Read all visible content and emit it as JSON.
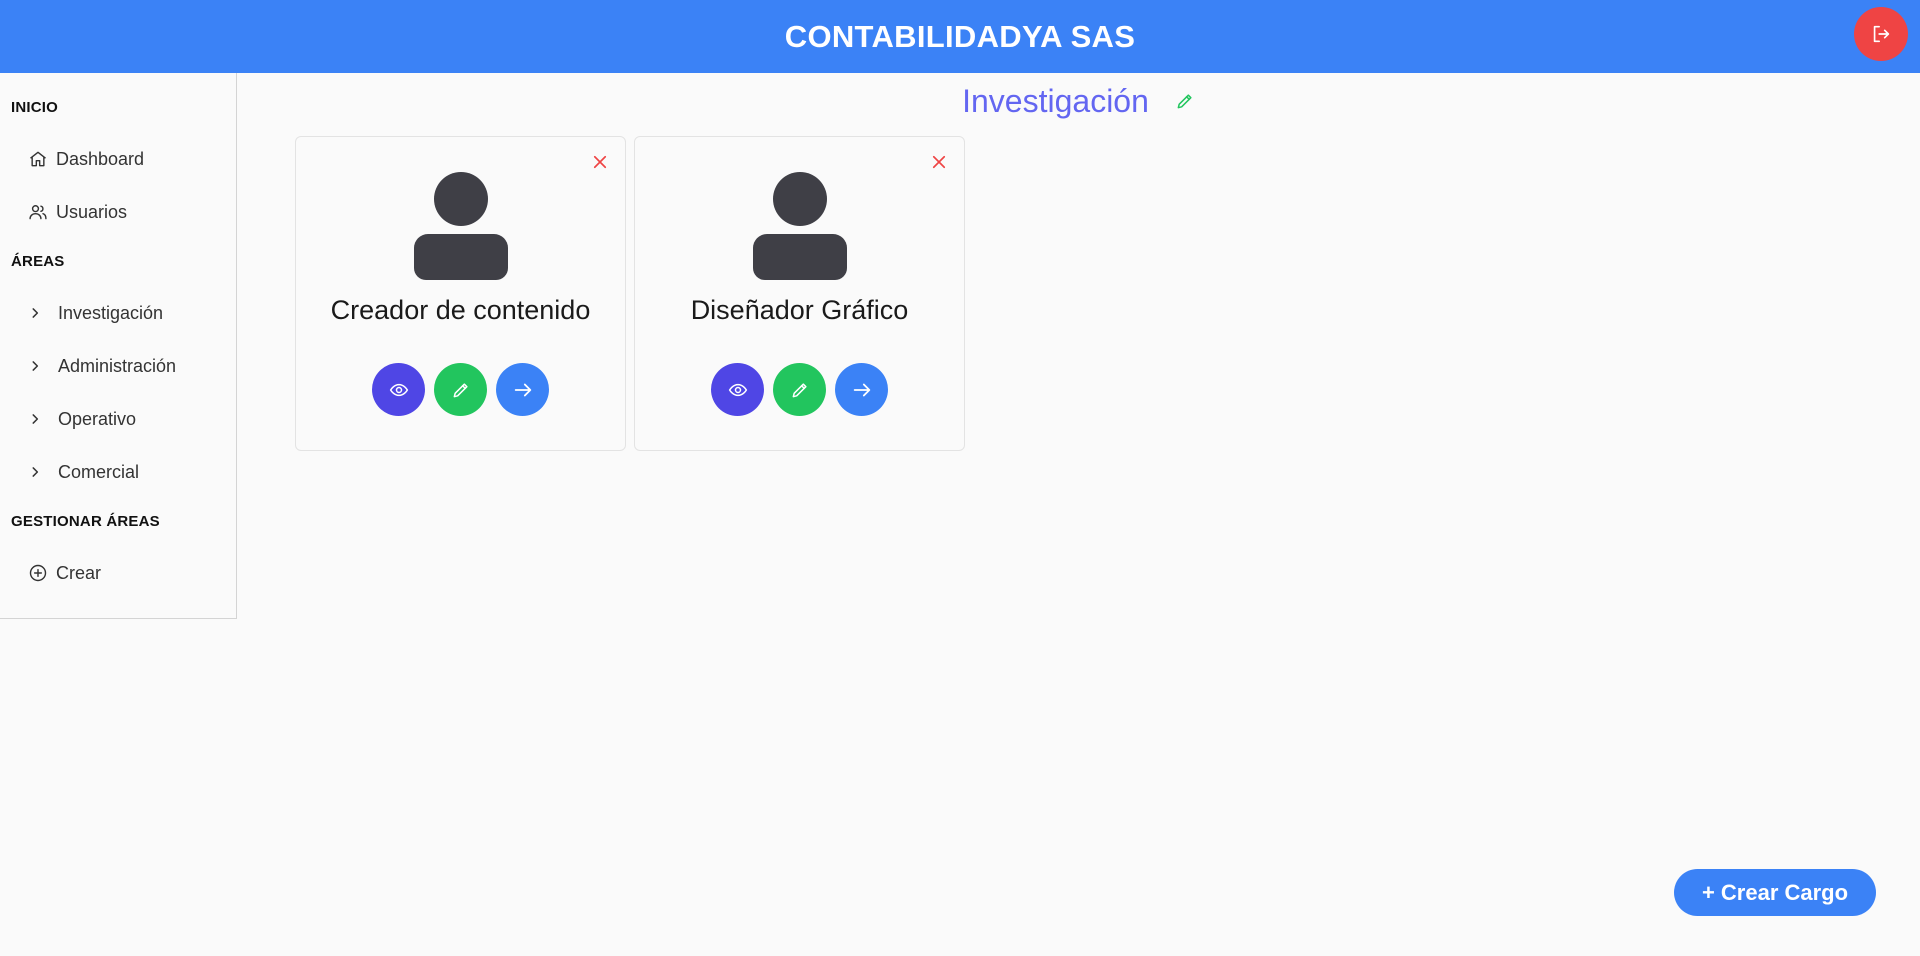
{
  "header": {
    "title": "CONTABILIDADYA SAS",
    "logout_icon": "logout-icon",
    "logout_color": "#ef4444",
    "background": "#3b82f6"
  },
  "sidebar": {
    "sections": {
      "inicio": "INICIO",
      "areas": "ÁREAS",
      "gestionar": "GESTIONAR ÁREAS"
    },
    "inicio_items": [
      {
        "label": "Dashboard",
        "icon": "home-icon"
      },
      {
        "label": "Usuarios",
        "icon": "users-icon"
      }
    ],
    "area_items": [
      {
        "label": "Investigación",
        "icon": "chevron-right-icon"
      },
      {
        "label": "Administración",
        "icon": "chevron-right-icon"
      },
      {
        "label": "Operativo",
        "icon": "chevron-right-icon"
      },
      {
        "label": "Comercial",
        "icon": "chevron-right-icon"
      }
    ],
    "gestionar_items": [
      {
        "label": "Crear",
        "icon": "plus-circle-icon"
      }
    ]
  },
  "main": {
    "area_title": "Investigación",
    "area_title_color": "#6366f1",
    "cards": [
      {
        "role": "Creador de contenido"
      },
      {
        "role": "Diseñador Gráfico"
      }
    ],
    "action_colors": {
      "view": "#4f46e5",
      "edit": "#22c55e",
      "go": "#3b82f6",
      "close": "#ef4444"
    }
  },
  "create_button": {
    "label": "+ Crear Cargo"
  }
}
